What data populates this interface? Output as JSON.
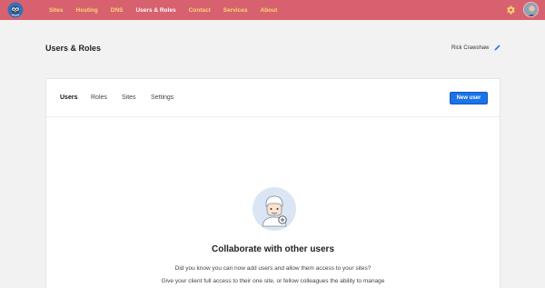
{
  "topbar": {
    "color": "#d8616f",
    "nav_color": "#f6d774",
    "logo_icon": "blue-bird-logo",
    "nav": [
      {
        "label": "Sites"
      },
      {
        "label": "Hosting"
      },
      {
        "label": "DNS"
      },
      {
        "label": "Users & Roles",
        "active": true
      },
      {
        "label": "Contact"
      },
      {
        "label": "Services"
      },
      {
        "label": "About"
      }
    ],
    "settings_icon": "gear-icon",
    "avatar_icon": "user-avatar"
  },
  "header": {
    "title": "Users & Roles",
    "user_name": "Rick Crawshaw",
    "edit_icon": "pencil-icon"
  },
  "panel": {
    "tabs": [
      {
        "label": "Users",
        "active": true
      },
      {
        "label": "Roles"
      },
      {
        "label": "Sites"
      },
      {
        "label": "Settings"
      }
    ],
    "new_user_label": "New user",
    "accent": "#1a73e8",
    "empty_state": {
      "illustration_icon": "add-user-illustration",
      "heading": "Collaborate with other users",
      "line1": "Did you know you can now add users and allow them access to your sites?",
      "line2": "Give your client full access to their one site, or fellow colleagues the ability to manage"
    }
  }
}
